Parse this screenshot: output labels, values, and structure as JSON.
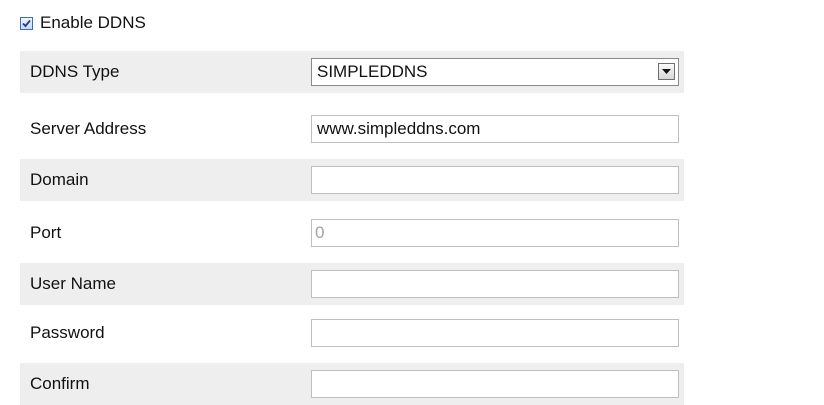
{
  "enable_ddns": {
    "label": "Enable DDNS",
    "checked": true
  },
  "rows": [
    {
      "label": "DDNS Type",
      "type": "select",
      "value": "SIMPLEDDNS"
    },
    {
      "label": "Server Address",
      "type": "text",
      "value": "www.simpleddns.com"
    },
    {
      "label": "Domain",
      "type": "text",
      "value": ""
    },
    {
      "label": "Port",
      "type": "text",
      "value": "0"
    },
    {
      "label": "User Name",
      "type": "text",
      "value": ""
    },
    {
      "label": "Password",
      "type": "password",
      "value": ""
    },
    {
      "label": "Confirm",
      "type": "password",
      "value": ""
    }
  ],
  "colors": {
    "row_shade": "#eeeeee",
    "field_border": "#bfbfbf",
    "disabled_text": "#a3a3a3",
    "checkbox_border": "#3b6db8"
  },
  "icons": {
    "checkbox": "checkmark-icon",
    "dropdown": "chevron-down-icon"
  }
}
